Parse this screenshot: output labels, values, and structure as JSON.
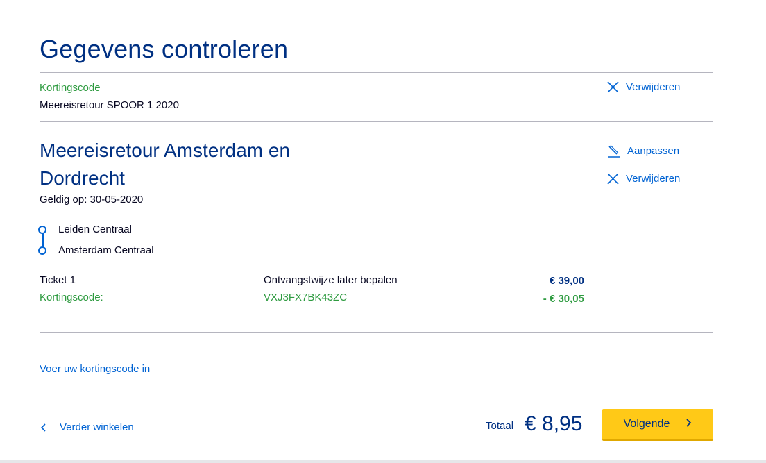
{
  "page": {
    "title": "Gegevens controleren"
  },
  "discount_block": {
    "label": "Kortingscode",
    "product": "Meereisretour SPOOR 1 2020",
    "remove_label": "Verwijderen"
  },
  "ticket": {
    "title": "Meereisretour Amsterdam en Dordrecht",
    "valid_label": "Geldig op: 30-05-2020",
    "edit_label": "Aanpassen",
    "remove_label": "Verwijderen",
    "route": {
      "from": "Leiden Centraal",
      "to": "Amsterdam Centraal"
    },
    "lines": [
      {
        "label": "Ticket 1",
        "detail": "Ontvangstwijze later bepalen",
        "amount": "€ 39,00"
      },
      {
        "label": "Kortingscode:",
        "detail": "VXJ3FX7BK43ZC",
        "amount": "- € 30,05"
      }
    ]
  },
  "discount_link": "Voer uw kortingscode in",
  "footer": {
    "back_label": "Verder winkelen",
    "total_label": "Totaal",
    "total_value": "€ 8,95",
    "next_label": "Volgende"
  },
  "colors": {
    "brand_blue": "#003082",
    "link_blue": "#0063d3",
    "green": "#2e9b40",
    "button_yellow": "#ffc917"
  }
}
